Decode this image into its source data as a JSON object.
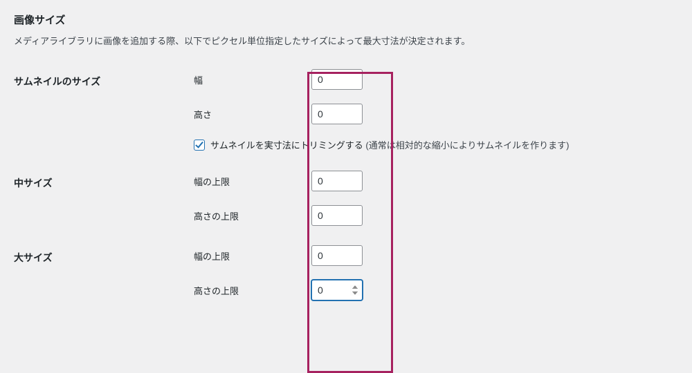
{
  "section": {
    "title": "画像サイズ",
    "description": "メディアライブラリに画像を追加する際、以下でピクセル単位指定したサイズによって最大寸法が決定されます。"
  },
  "thumbnail": {
    "heading": "サムネイルのサイズ",
    "width_label": "幅",
    "width_value": "0",
    "height_label": "高さ",
    "height_value": "0",
    "crop_checked": true,
    "crop_label": "サムネイルを実寸法にトリミングする",
    "crop_note": "(通常は相対的な縮小によりサムネイルを作ります)"
  },
  "medium": {
    "heading": "中サイズ",
    "width_label": "幅の上限",
    "width_value": "0",
    "height_label": "高さの上限",
    "height_value": "0"
  },
  "large": {
    "heading": "大サイズ",
    "width_label": "幅の上限",
    "width_value": "0",
    "height_label": "高さの上限",
    "height_value": "0"
  },
  "highlight": {
    "color": "#a6215f"
  }
}
